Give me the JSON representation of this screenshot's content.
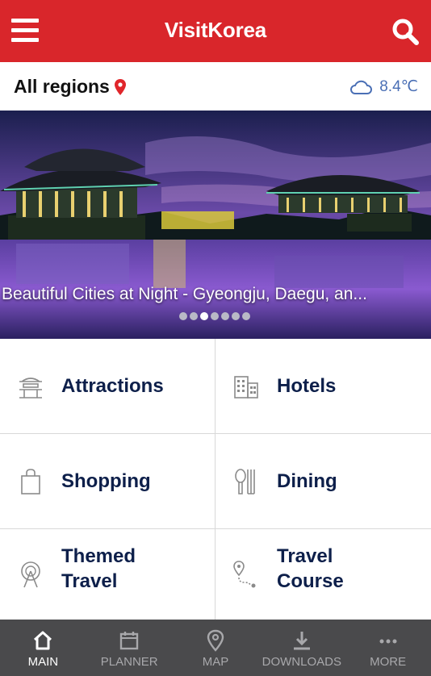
{
  "header": {
    "title": "VisitKorea",
    "menu_icon": "hamburger-icon",
    "search_icon": "search-icon",
    "brand_color": "#d9262b"
  },
  "region_bar": {
    "region": "All regions",
    "weather": "8.4℃",
    "weather_icon": "cloud-icon"
  },
  "hero": {
    "caption": "Beautiful Cities at Night - Gyeongju, Daegu, an...",
    "slide_count": 7,
    "active_slide": 3
  },
  "categories": [
    {
      "label": "Attractions",
      "icon": "pavilion-icon"
    },
    {
      "label": "Hotels",
      "icon": "building-icon"
    },
    {
      "label": "Shopping",
      "icon": "shopping-bag-icon"
    },
    {
      "label": "Dining",
      "icon": "spoon-fork-icon"
    },
    {
      "label": "Themed Travel",
      "line1": "Themed",
      "line2": "Travel",
      "icon": "ferris-wheel-icon"
    },
    {
      "label": "Travel Course",
      "line1": "Travel",
      "line2": "Course",
      "icon": "route-icon"
    }
  ],
  "bottom_nav": {
    "items": [
      {
        "label": "MAIN",
        "icon": "home-icon",
        "active": true
      },
      {
        "label": "PLANNER",
        "icon": "calendar-icon",
        "active": false
      },
      {
        "label": "MAP",
        "icon": "map-pin-icon",
        "active": false
      },
      {
        "label": "DOWNLOADS",
        "icon": "download-icon",
        "active": false
      },
      {
        "label": "MORE",
        "icon": "more-icon",
        "active": false
      }
    ]
  }
}
